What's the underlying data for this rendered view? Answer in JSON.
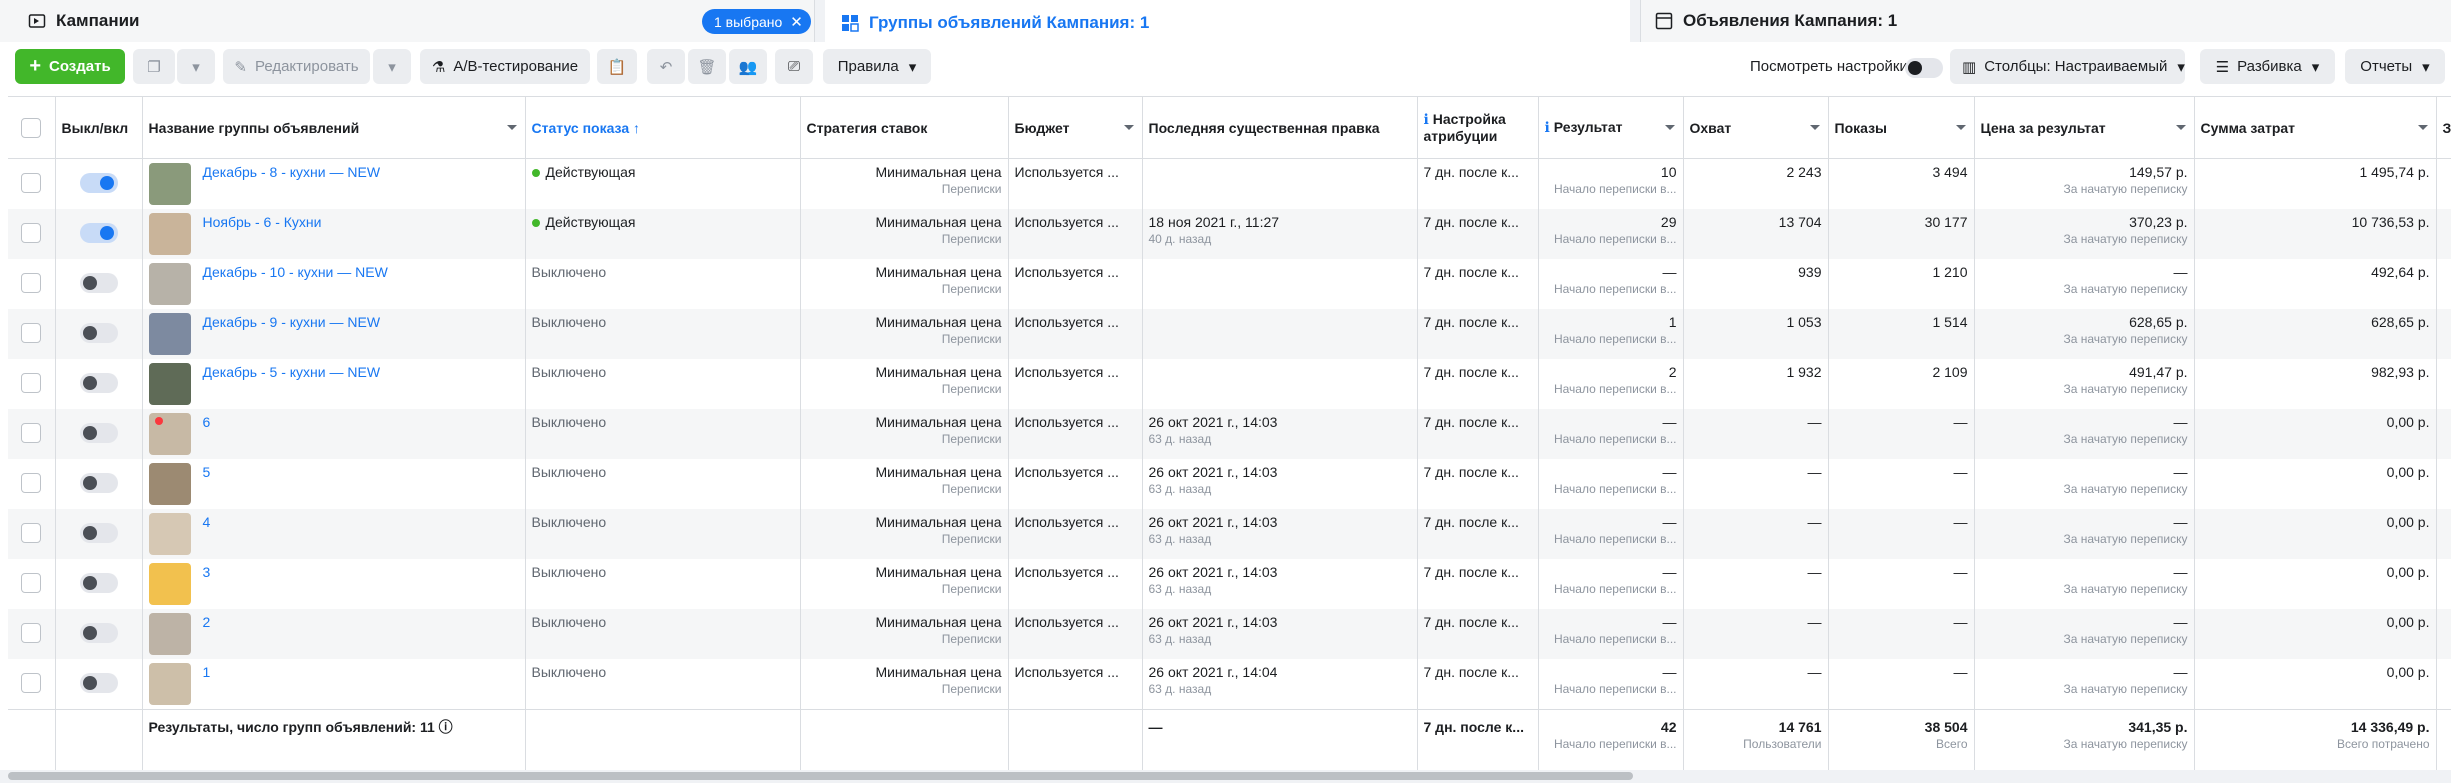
{
  "tabs": {
    "campaigns": "Кампании",
    "selected_pill": "1 выбрано",
    "adsets": "Группы объявлений Кампания: 1",
    "ads": "Объявления Кампания: 1"
  },
  "toolbar": {
    "create": "Создать",
    "edit": "Редактировать",
    "ab_test": "A/B-тестирование",
    "rules": "Правила",
    "view_settings": "Посмотреть настройки",
    "columns": "Столбцы: Настраиваемый",
    "breakdown": "Разбивка",
    "reports": "Отчеты"
  },
  "columns": {
    "toggle": "Выкл/вкл",
    "name": "Название группы объявлений",
    "status": "Статус показа ↑",
    "bid": "Стратегия ставок",
    "budget": "Бюджет",
    "last_edit": "Последняя существенная правка",
    "attribution": "Настройка атрибуции",
    "result": "Результат",
    "reach": "Охват",
    "impressions": "Показы",
    "cpr": "Цена за результат",
    "spend": "Сумма затрат",
    "more": "З"
  },
  "rows": [
    {
      "on": true,
      "name": "Декабрь - 8 - кухни — NEW",
      "status": "Действующая",
      "active": true,
      "bid": "Минимальная цена",
      "bid_sub": "Переписки",
      "budget": "Используется ...",
      "edit": "",
      "edit_sub": "",
      "attr": "7 дн. после к...",
      "result": "10",
      "result_sub": "Начало переписки в...",
      "reach": "2 243",
      "impr": "3 494",
      "cpr": "149,57 р.",
      "cpr_sub": "За начатую переписку",
      "spend": "1 495,74 р.",
      "thumb": "#8a9a7b"
    },
    {
      "on": true,
      "name": "Ноябрь - 6 - Кухни",
      "status": "Действующая",
      "active": true,
      "bid": "Минимальная цена",
      "bid_sub": "Переписки",
      "budget": "Используется ...",
      "edit": "18 ноя 2021 г., 11:27",
      "edit_sub": "40 д. назад",
      "attr": "7 дн. после к...",
      "result": "29",
      "result_sub": "Начало переписки в...",
      "reach": "13 704",
      "impr": "30 177",
      "cpr": "370,23 р.",
      "cpr_sub": "За начатую переписку",
      "spend": "10 736,53 р.",
      "thumb": "#c9b49a"
    },
    {
      "on": false,
      "name": "Декабрь - 10 - кухни — NEW",
      "status": "Выключено",
      "active": false,
      "bid": "Минимальная цена",
      "bid_sub": "Переписки",
      "budget": "Используется ...",
      "edit": "",
      "edit_sub": "",
      "attr": "7 дн. после к...",
      "result": "—",
      "result_sub": "Начало переписки в...",
      "reach": "939",
      "impr": "1 210",
      "cpr": "—",
      "cpr_sub": "За начатую переписку",
      "spend": "492,64 р.",
      "thumb": "#b7b2a8"
    },
    {
      "on": false,
      "name": "Декабрь - 9 - кухни — NEW",
      "status": "Выключено",
      "active": false,
      "bid": "Минимальная цена",
      "bid_sub": "Переписки",
      "budget": "Используется ...",
      "edit": "",
      "edit_sub": "",
      "attr": "7 дн. после к...",
      "result": "1",
      "result_sub": "Начало переписки в...",
      "reach": "1 053",
      "impr": "1 514",
      "cpr": "628,65 р.",
      "cpr_sub": "За начатую переписку",
      "spend": "628,65 р.",
      "thumb": "#7d8aa0"
    },
    {
      "on": false,
      "name": "Декабрь - 5 - кухни — NEW",
      "status": "Выключено",
      "active": false,
      "bid": "Минимальная цена",
      "bid_sub": "Переписки",
      "budget": "Используется ...",
      "edit": "",
      "edit_sub": "",
      "attr": "7 дн. после к...",
      "result": "2",
      "result_sub": "Начало переписки в...",
      "reach": "1 932",
      "impr": "2 109",
      "cpr": "491,47 р.",
      "cpr_sub": "За начатую переписку",
      "spend": "982,93 р.",
      "thumb": "#5f6b57"
    },
    {
      "on": false,
      "name": "6",
      "status": "Выключено",
      "active": false,
      "bid": "Минимальная цена",
      "bid_sub": "Переписки",
      "budget": "Используется ...",
      "edit": "26 окт 2021 г., 14:03",
      "edit_sub": "63 д. назад",
      "attr": "7 дн. после к...",
      "result": "—",
      "result_sub": "Начало переписки в...",
      "reach": "—",
      "impr": "—",
      "cpr": "—",
      "cpr_sub": "За начатую переписку",
      "spend": "0,00 р.",
      "thumb": "#c7b9a5"
    },
    {
      "on": false,
      "name": "5",
      "status": "Выключено",
      "active": false,
      "bid": "Минимальная цена",
      "bid_sub": "Переписки",
      "budget": "Используется ...",
      "edit": "26 окт 2021 г., 14:03",
      "edit_sub": "63 д. назад",
      "attr": "7 дн. после к...",
      "result": "—",
      "result_sub": "Начало переписки в...",
      "reach": "—",
      "impr": "—",
      "cpr": "—",
      "cpr_sub": "За начатую переписку",
      "spend": "0,00 р.",
      "thumb": "#9c8a72"
    },
    {
      "on": false,
      "name": "4",
      "status": "Выключено",
      "active": false,
      "bid": "Минимальная цена",
      "bid_sub": "Переписки",
      "budget": "Используется ...",
      "edit": "26 окт 2021 г., 14:03",
      "edit_sub": "63 д. назад",
      "attr": "7 дн. после к...",
      "result": "—",
      "result_sub": "Начало переписки в...",
      "reach": "—",
      "impr": "—",
      "cpr": "—",
      "cpr_sub": "За начатую переписку",
      "spend": "0,00 р.",
      "thumb": "#d6c8b4"
    },
    {
      "on": false,
      "name": "3",
      "status": "Выключено",
      "active": false,
      "bid": "Минимальная цена",
      "bid_sub": "Переписки",
      "budget": "Используется ...",
      "edit": "26 окт 2021 г., 14:03",
      "edit_sub": "63 д. назад",
      "attr": "7 дн. после к...",
      "result": "—",
      "result_sub": "Начало переписки в...",
      "reach": "—",
      "impr": "—",
      "cpr": "—",
      "cpr_sub": "За начатую переписку",
      "spend": "0,00 р.",
      "thumb": "#f2c14e"
    },
    {
      "on": false,
      "name": "2",
      "status": "Выключено",
      "active": false,
      "bid": "Минимальная цена",
      "bid_sub": "Переписки",
      "budget": "Используется ...",
      "edit": "26 окт 2021 г., 14:03",
      "edit_sub": "63 д. назад",
      "attr": "7 дн. после к...",
      "result": "—",
      "result_sub": "Начало переписки в...",
      "reach": "—",
      "impr": "—",
      "cpr": "—",
      "cpr_sub": "За начатую переписку",
      "spend": "0,00 р.",
      "thumb": "#bdb3a6"
    },
    {
      "on": false,
      "name": "1",
      "status": "Выключено",
      "active": false,
      "bid": "Минимальная цена",
      "bid_sub": "Переписки",
      "budget": "Используется ...",
      "edit": "26 окт 2021 г., 14:04",
      "edit_sub": "63 д. назад",
      "attr": "7 дн. после к...",
      "result": "—",
      "result_sub": "Начало переписки в...",
      "reach": "—",
      "impr": "—",
      "cpr": "—",
      "cpr_sub": "За начатую переписку",
      "spend": "0,00 р.",
      "thumb": "#cdbfa9"
    }
  ],
  "total": {
    "label": "Результаты, число групп объявлений: 11",
    "edit": "—",
    "attr": "7 дн. после к...",
    "result": "42",
    "result_sub": "Начало переписки в...",
    "reach": "14 761",
    "reach_sub": "Пользователи",
    "impr": "38 504",
    "impr_sub": "Всего",
    "cpr": "341,35 р.",
    "cpr_sub": "За начатую переписку",
    "spend": "14 336,49 р.",
    "spend_sub": "Всего потрачено"
  },
  "colors": {
    "accent": "#1877f2",
    "create": "#42b72a",
    "active_dot": "#42b72a"
  }
}
